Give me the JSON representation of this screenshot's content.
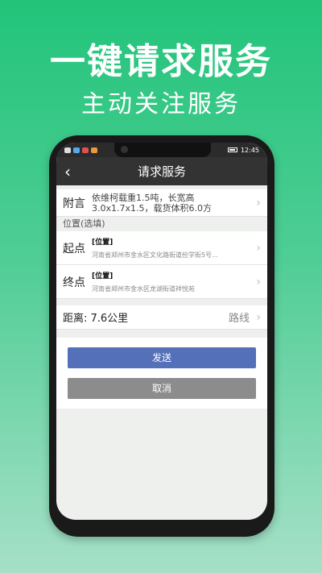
{
  "promo": {
    "title": "一键请求服务",
    "subtitle": "主动关注服务"
  },
  "status_bar": {
    "time": "12:45"
  },
  "nav": {
    "title": "请求服务",
    "back_icon": "back-arrow-icon"
  },
  "note": {
    "label": "附言",
    "text": "依维柯载重1.5吨，长宽高3.0x1.7x1.5，载货体积6.0方"
  },
  "location": {
    "section_title": "位置(选填)",
    "start": {
      "label": "起点",
      "tag": "[位置]",
      "address": "河南省郑州市金水区文化路街道俭学街5号..."
    },
    "end": {
      "label": "终点",
      "tag": "[位置]",
      "address": "河南省郑州市金水区龙湖街道祥悦苑"
    }
  },
  "distance": {
    "text": "距离: 7.6公里",
    "route_label": "路线"
  },
  "actions": {
    "send_label": "发送",
    "cancel_label": "取消"
  },
  "colors": {
    "brand_green": "#22c47a",
    "send_button": "#5470b8",
    "cancel_button": "#8c8c8c",
    "nav_bar": "#333333"
  }
}
